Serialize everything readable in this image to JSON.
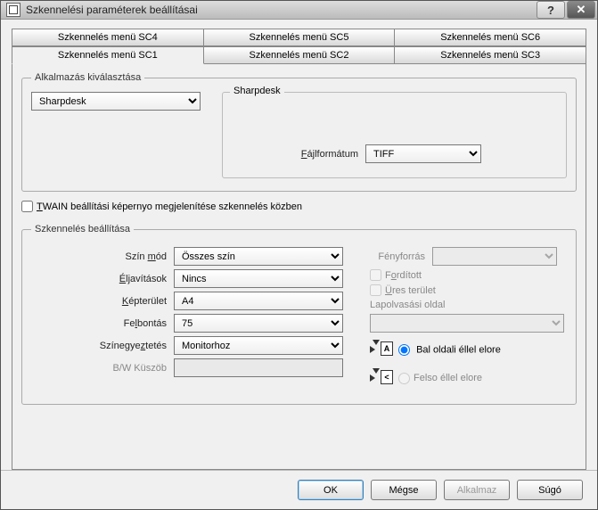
{
  "window": {
    "title": "Szkennelési paraméterek beállításai"
  },
  "tabs": {
    "sc4": "Szkennelés menü SC4",
    "sc5": "Szkennelés menü SC5",
    "sc6": "Szkennelés menü SC6",
    "sc1": "Szkennelés menü SC1",
    "sc2": "Szkennelés menü SC2",
    "sc3": "Szkennelés menü SC3"
  },
  "app_selection": {
    "legend": "Alkalmazás kiválasztása",
    "selected": "Sharpdesk",
    "box_label": "Sharpdesk",
    "file_format_label": "Fájlformátum",
    "file_format_value": "TIFF"
  },
  "twain_checkbox": "TWAIN beállítási képernyo megjelenítése szkennelés közben",
  "scan_settings": {
    "legend": "Szkennelés beállítása",
    "color_mode_label": "Szín mód",
    "color_mode_value": "Összes szín",
    "edge_label": "Éljavítások",
    "edge_value": "Nincs",
    "image_area_label": "Képterület",
    "image_area_value": "A4",
    "resolution_label": "Felbontás",
    "resolution_value": "75",
    "color_match_label": "Színegyeztetés",
    "color_match_value": "Monitorhoz",
    "bw_threshold_label": "B/W Küszöb",
    "light_source_label": "Fényforrás",
    "inverted_label": "Fordított",
    "empty_area_label": "Üres terület",
    "scan_side_label": "Lapolvasási oldal",
    "left_edge_first": "Bal oldali éllel elore",
    "top_edge_first": "Felso éllel elore"
  },
  "buttons": {
    "ok": "OK",
    "cancel": "Mégse",
    "apply": "Alkalmaz",
    "help": "Súgó"
  }
}
